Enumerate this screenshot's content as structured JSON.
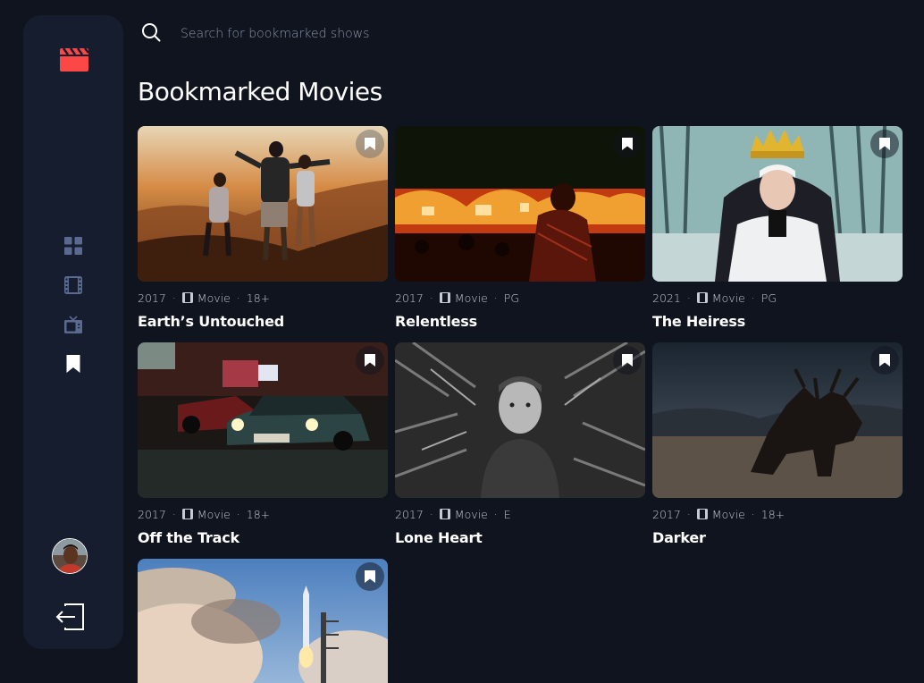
{
  "search": {
    "placeholder": "Search for bookmarked shows"
  },
  "page_title": "Bookmarked Movies",
  "colors": {
    "background": "#10141e",
    "sidebar": "#161d2f",
    "accent_red": "#fc4747",
    "nav_inactive": "#5a698f",
    "nav_active": "#ffffff"
  },
  "sidebar": {
    "logo_icon": "movie-clapper-icon",
    "items": [
      {
        "id": "home",
        "icon": "grid-icon",
        "active": false
      },
      {
        "id": "movies",
        "icon": "film-icon",
        "active": false
      },
      {
        "id": "tv",
        "icon": "tv-icon",
        "active": false
      },
      {
        "id": "bookmarks",
        "icon": "bookmark-icon",
        "active": true
      }
    ],
    "logout_icon": "logout-icon"
  },
  "movies": [
    {
      "year": "2017",
      "category": "Movie",
      "rating": "18+",
      "title": "Earth’s Untouched",
      "bookmarked": true
    },
    {
      "year": "2017",
      "category": "Movie",
      "rating": "PG",
      "title": "Relentless",
      "bookmarked": true
    },
    {
      "year": "2021",
      "category": "Movie",
      "rating": "PG",
      "title": "The Heiress",
      "bookmarked": true
    },
    {
      "year": "2017",
      "category": "Movie",
      "rating": "18+",
      "title": "Off the Track",
      "bookmarked": true
    },
    {
      "year": "2017",
      "category": "Movie",
      "rating": "E",
      "title": "Lone Heart",
      "bookmarked": true
    },
    {
      "year": "2017",
      "category": "Movie",
      "rating": "18+",
      "title": "Darker",
      "bookmarked": true
    },
    {
      "bookmarked": true
    }
  ]
}
